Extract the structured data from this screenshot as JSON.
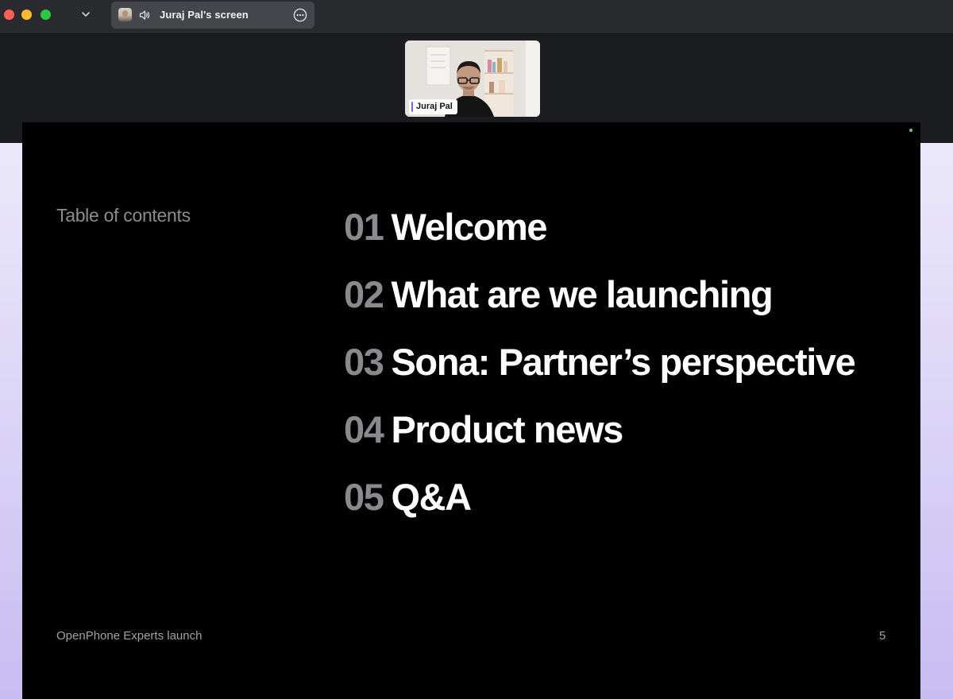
{
  "window": {
    "tab_title": "Juraj Pal's screen",
    "icons": [
      "close-icon",
      "minimize-icon",
      "maximize-icon",
      "chevron-down-icon",
      "speaker-icon",
      "more-options-icon"
    ]
  },
  "video": {
    "participant_name": "Juraj Pal"
  },
  "slide": {
    "heading": "Table of contents",
    "items": [
      {
        "number": "01",
        "title": "Welcome"
      },
      {
        "number": "02",
        "title": "What are we launching"
      },
      {
        "number": "03",
        "title": "Sona: Partner’s perspective"
      },
      {
        "number": "04",
        "title": "Product news"
      },
      {
        "number": "05",
        "title": "Q&A"
      }
    ],
    "footer": "OpenPhone Experts launch",
    "page_number": "5"
  },
  "colors": {
    "slide_background": "#000000",
    "number_gray": "#8a8a8e",
    "title_white": "#ffffff",
    "backdrop_lavender": "#d9d2f6"
  }
}
